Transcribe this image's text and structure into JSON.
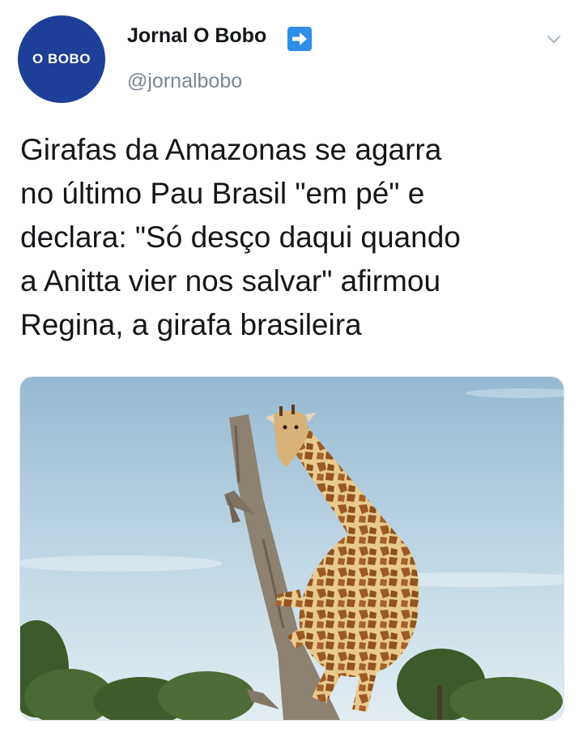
{
  "tweet": {
    "avatar": {
      "text": "O BOBO",
      "color": "#1d3f97"
    },
    "author": {
      "display_name": "Jornal O Bobo",
      "handle": "@jornalbobo",
      "badge_icon": "right-arrow-emoji-icon"
    },
    "menu_icon": "chevron-down-icon",
    "text": "Girafas da Amazonas se agarra\nno último Pau Brasil \"em pé\" e\ndeclara: \"Só desço daqui quando\na Anitta vier nos salvar\" afirmou\nRegina, a girafa brasileira",
    "media": {
      "kind": "photo",
      "subject": "giraffe-climbing-tree"
    }
  },
  "colors": {
    "accent": "#2f8ee8",
    "text_primary": "#14171a",
    "text_secondary": "#7a8791",
    "sky_top": "#9cbfd6",
    "sky_bottom": "#dfeaf0"
  }
}
